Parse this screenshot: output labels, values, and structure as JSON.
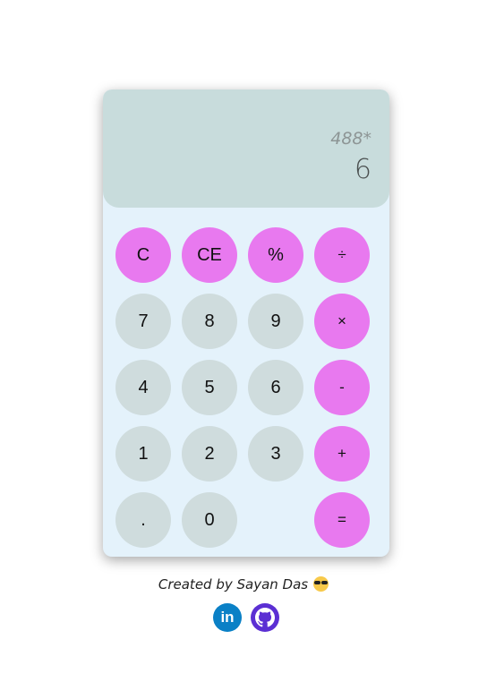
{
  "display": {
    "previous_operand": "488*",
    "current_operand": "6"
  },
  "keys": [
    {
      "label": "C",
      "name": "clear-button",
      "kind": "op"
    },
    {
      "label": "CE",
      "name": "clear-entry-button",
      "kind": "op"
    },
    {
      "label": "%",
      "name": "percent-button",
      "kind": "op"
    },
    {
      "label": "÷",
      "name": "divide-button",
      "kind": "op"
    },
    {
      "label": "7",
      "name": "digit-7-button",
      "kind": "num"
    },
    {
      "label": "8",
      "name": "digit-8-button",
      "kind": "num"
    },
    {
      "label": "9",
      "name": "digit-9-button",
      "kind": "num"
    },
    {
      "label": "×",
      "name": "multiply-button",
      "kind": "op"
    },
    {
      "label": "4",
      "name": "digit-4-button",
      "kind": "num"
    },
    {
      "label": "5",
      "name": "digit-5-button",
      "kind": "num"
    },
    {
      "label": "6",
      "name": "digit-6-button",
      "kind": "num"
    },
    {
      "label": "-",
      "name": "subtract-button",
      "kind": "op"
    },
    {
      "label": "1",
      "name": "digit-1-button",
      "kind": "num"
    },
    {
      "label": "2",
      "name": "digit-2-button",
      "kind": "num"
    },
    {
      "label": "3",
      "name": "digit-3-button",
      "kind": "num"
    },
    {
      "label": "+",
      "name": "add-button",
      "kind": "op"
    },
    {
      "label": ".",
      "name": "decimal-button",
      "kind": "num"
    },
    {
      "label": "0",
      "name": "digit-0-button",
      "kind": "num"
    },
    {
      "label": "=",
      "name": "equals-button",
      "kind": "op"
    }
  ],
  "footer": {
    "credit": "Created by Sayan Das",
    "emoji_icon": "sunglasses-emoji-icon",
    "linkedin_label": "in",
    "linkedin_icon": "linkedin-icon",
    "github_icon": "github-icon"
  },
  "colors": {
    "operator_key": "#e879ef",
    "number_key": "#cfdcdd",
    "display_bg": "#c8dcdc",
    "body_bg": "#e4f2fb",
    "linkedin": "#0a80c6",
    "github": "#5b2fd3"
  }
}
